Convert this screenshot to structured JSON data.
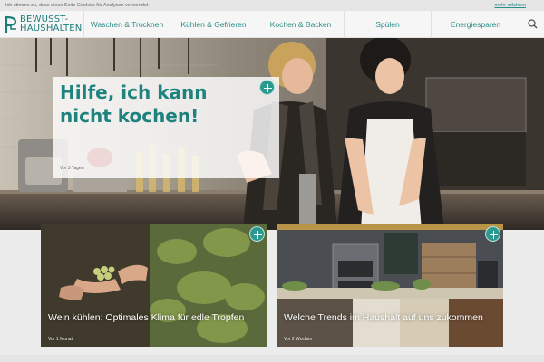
{
  "cookie": {
    "text": "Ich stimme zu, dass diese Seite Cookies für Analysen verwendet",
    "link": "mehr erfahren"
  },
  "logo": {
    "line1": "BEWUSST-",
    "line2": "HAUSHALTEN"
  },
  "nav": {
    "items": [
      {
        "label": "Waschen & Trocknen"
      },
      {
        "label": "Kühlen & Gefrieren"
      },
      {
        "label": "Kochen & Backen"
      },
      {
        "label": "Spülen"
      },
      {
        "label": "Energiesparen"
      }
    ],
    "search_icon": "search-icon"
  },
  "hero": {
    "title": "Hilfe, ich kann nicht kochen!",
    "meta": "Vor 3 Tagen"
  },
  "cards": [
    {
      "title": "Wein kühlen: Optimales Klima für edle Tropfen",
      "meta": "Vor 1 Monat"
    },
    {
      "title": "Welche Trends im Haushalt auf uns zukommen",
      "meta": "Vor 2 Wochen"
    }
  ],
  "colors": {
    "accent": "#2a8d88",
    "plus": "#2a9a90"
  }
}
